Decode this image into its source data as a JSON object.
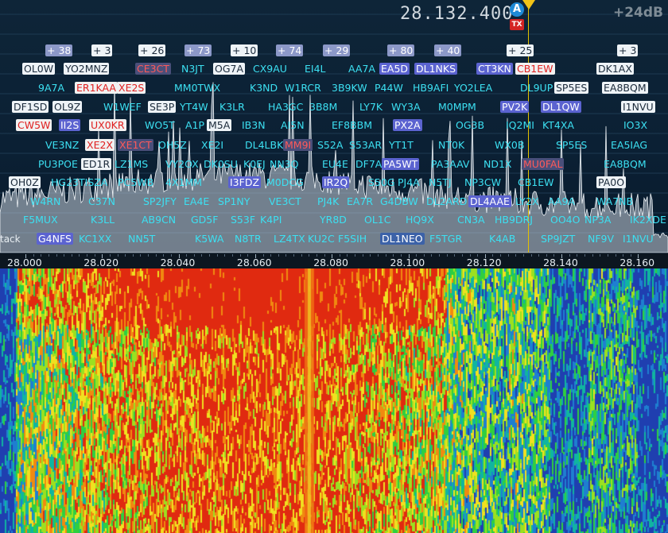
{
  "vfo": {
    "frequency": "28.132.400",
    "vfo_label": "A",
    "tx_label": "TX",
    "gain": "+24dB"
  },
  "partial_label": "tack",
  "colors": {
    "marker": "#f2c316",
    "tx": "#d42424",
    "vfo": "#1e8ad6",
    "callsign": "#3ce0f2"
  },
  "scale": {
    "labels": [
      "28.000",
      "28.020",
      "28.040",
      "28.060",
      "28.080",
      "28.100",
      "28.120",
      "28.140",
      "28.160"
    ]
  },
  "spots": [
    {
      "t": "+ 38",
      "s": "nb"
    },
    {
      "t": "+ 3",
      "s": "w"
    },
    {
      "t": "+ 26",
      "s": "w"
    },
    {
      "t": "+ 73",
      "s": "nb"
    },
    {
      "t": "+ 10",
      "s": "w"
    },
    {
      "t": "+ 74",
      "s": "nb"
    },
    {
      "t": "+ 29",
      "s": "nb"
    },
    {
      "t": "+ 80",
      "s": "nb"
    },
    {
      "t": "+ 40",
      "s": "nb"
    },
    {
      "t": "+ 25",
      "s": "w"
    },
    {
      "t": "+ 3",
      "s": "w"
    },
    {
      "t": "OL0W",
      "s": "w"
    },
    {
      "t": "YO2MNZ",
      "s": "w"
    },
    {
      "t": "CE3CT",
      "s": "rb"
    },
    {
      "t": "N3JT",
      "s": "c"
    },
    {
      "t": "OG7A",
      "s": "w"
    },
    {
      "t": "CX9AU",
      "s": "c"
    },
    {
      "t": "EI4L",
      "s": "c"
    },
    {
      "t": "AA7A",
      "s": "c"
    },
    {
      "t": "EA5D",
      "s": "b"
    },
    {
      "t": "DL1NKS",
      "s": "b"
    },
    {
      "t": "CT3KN",
      "s": "b"
    },
    {
      "t": "CB1EW",
      "s": "r"
    },
    {
      "t": "DK1AX",
      "s": "w"
    },
    {
      "t": "9A7A",
      "s": "c"
    },
    {
      "t": "ER1KAA",
      "s": "r"
    },
    {
      "t": "XE2S",
      "s": "r"
    },
    {
      "t": "MM0TWX",
      "s": "c"
    },
    {
      "t": "K3ND",
      "s": "c"
    },
    {
      "t": "W1RCR",
      "s": "c"
    },
    {
      "t": "3B9KW",
      "s": "c"
    },
    {
      "t": "P44W",
      "s": "c"
    },
    {
      "t": "HB9AFI",
      "s": "c"
    },
    {
      "t": "YO2LEA",
      "s": "c"
    },
    {
      "t": "DL9UP",
      "s": "c"
    },
    {
      "t": "SP5ES",
      "s": "w"
    },
    {
      "t": "EA8BQM",
      "s": "w"
    },
    {
      "t": "DF1SD",
      "s": "w"
    },
    {
      "t": "OL9Z",
      "s": "w"
    },
    {
      "t": "W1WEF",
      "s": "c"
    },
    {
      "t": "SE3P",
      "s": "w"
    },
    {
      "t": "YT4W",
      "s": "c"
    },
    {
      "t": "K3LR",
      "s": "c"
    },
    {
      "t": "HA3GC",
      "s": "c"
    },
    {
      "t": "3B8M",
      "s": "c"
    },
    {
      "t": "LY7K",
      "s": "c"
    },
    {
      "t": "WY3A",
      "s": "c"
    },
    {
      "t": "M0MPM",
      "s": "c"
    },
    {
      "t": "PV2K",
      "s": "b"
    },
    {
      "t": "DL1QW",
      "s": "b"
    },
    {
      "t": "I1NVU",
      "s": "w"
    },
    {
      "t": "CW5W",
      "s": "r"
    },
    {
      "t": "II2S",
      "s": "b"
    },
    {
      "t": "UX0KR",
      "s": "r"
    },
    {
      "t": "WO5T",
      "s": "c"
    },
    {
      "t": "A1P",
      "s": "c"
    },
    {
      "t": "M5A",
      "s": "w"
    },
    {
      "t": "IB3N",
      "s": "c"
    },
    {
      "t": "AI5N",
      "s": "c"
    },
    {
      "t": "EF8BBM",
      "s": "c"
    },
    {
      "t": "PX2A",
      "s": "b"
    },
    {
      "t": "OG3B",
      "s": "c"
    },
    {
      "t": "IQ2MI",
      "s": "c"
    },
    {
      "t": "KT4XA",
      "s": "c"
    },
    {
      "t": "IO3X",
      "s": "c"
    },
    {
      "t": "VE3NZ",
      "s": "c"
    },
    {
      "t": "XE2X",
      "s": "r"
    },
    {
      "t": "XE1CT",
      "s": "rb"
    },
    {
      "t": "OH5Z",
      "s": "c"
    },
    {
      "t": "XE2I",
      "s": "c"
    },
    {
      "t": "DL4LBK",
      "s": "c"
    },
    {
      "t": "MM9I",
      "s": "rb"
    },
    {
      "t": "S52A",
      "s": "c"
    },
    {
      "t": "S53AR",
      "s": "c"
    },
    {
      "t": "YT1T",
      "s": "c"
    },
    {
      "t": "NT0K",
      "s": "c"
    },
    {
      "t": "WX0B",
      "s": "c"
    },
    {
      "t": "SP5ES",
      "s": "c"
    },
    {
      "t": "EA5IAG",
      "s": "c"
    },
    {
      "t": "PU3POE",
      "s": "c"
    },
    {
      "t": "ED1R",
      "s": "w"
    },
    {
      "t": "LZ1MS",
      "s": "c"
    },
    {
      "t": "VY2OX",
      "s": "c"
    },
    {
      "t": "DK0SU",
      "s": "c"
    },
    {
      "t": "K0EJ",
      "s": "c"
    },
    {
      "t": "NN3Q",
      "s": "c"
    },
    {
      "t": "EU4E",
      "s": "c"
    },
    {
      "t": "DF7A",
      "s": "c"
    },
    {
      "t": "PA5WT",
      "s": "b"
    },
    {
      "t": "PA3AAV",
      "s": "c"
    },
    {
      "t": "ND1X",
      "s": "c"
    },
    {
      "t": "MU0FAL",
      "s": "rb"
    },
    {
      "t": "EA8BQM",
      "s": "c"
    },
    {
      "t": "OH0Z",
      "s": "w"
    },
    {
      "t": "HG23TISZA",
      "s": "c"
    },
    {
      "t": "PC5WB",
      "s": "c"
    },
    {
      "t": "4X1MM",
      "s": "c"
    },
    {
      "t": "I3FDZ",
      "s": "b"
    },
    {
      "t": "M0DCG",
      "s": "c"
    },
    {
      "t": "IR2Q",
      "s": "b"
    },
    {
      "t": "S50G",
      "s": "c"
    },
    {
      "t": "PJ4A",
      "s": "c"
    },
    {
      "t": "N5TJ",
      "s": "c"
    },
    {
      "t": "NP3CW",
      "s": "c"
    },
    {
      "t": "CB1EW",
      "s": "c"
    },
    {
      "t": "PA0O",
      "s": "w"
    },
    {
      "t": "W4RN",
      "s": "c"
    },
    {
      "t": "C37N",
      "s": "c"
    },
    {
      "t": "SP2JFY",
      "s": "c"
    },
    {
      "t": "EA4E",
      "s": "c"
    },
    {
      "t": "SP1NY",
      "s": "c"
    },
    {
      "t": "VE3CT",
      "s": "c"
    },
    {
      "t": "PJ4K",
      "s": "c"
    },
    {
      "t": "EA7R",
      "s": "c"
    },
    {
      "t": "G4DBW",
      "s": "c"
    },
    {
      "t": "DL2ARD",
      "s": "c"
    },
    {
      "t": "DL4AAE",
      "s": "b"
    },
    {
      "t": "LY2X",
      "s": "c"
    },
    {
      "t": "AA9A",
      "s": "c"
    },
    {
      "t": "WA7NB",
      "s": "c"
    },
    {
      "t": "F5MUX",
      "s": "c"
    },
    {
      "t": "K3LL",
      "s": "c"
    },
    {
      "t": "AB9CN",
      "s": "c"
    },
    {
      "t": "GD5F",
      "s": "c"
    },
    {
      "t": "S53F",
      "s": "c"
    },
    {
      "t": "K4PI",
      "s": "c"
    },
    {
      "t": "YR8D",
      "s": "c"
    },
    {
      "t": "OL1C",
      "s": "c"
    },
    {
      "t": "HQ9X",
      "s": "c"
    },
    {
      "t": "CN3A",
      "s": "c"
    },
    {
      "t": "HB9DRJ",
      "s": "c"
    },
    {
      "t": "OO4O",
      "s": "c"
    },
    {
      "t": "NP3A",
      "s": "c"
    },
    {
      "t": "IK2XDE",
      "s": "c"
    },
    {
      "t": "G4NFS",
      "s": "b"
    },
    {
      "t": "KC1XX",
      "s": "c"
    },
    {
      "t": "NN5T",
      "s": "c"
    },
    {
      "t": "K5WA",
      "s": "c"
    },
    {
      "t": "N8TR",
      "s": "c"
    },
    {
      "t": "LZ4TX",
      "s": "c"
    },
    {
      "t": "KU2C",
      "s": "c"
    },
    {
      "t": "F5SIH",
      "s": "c"
    },
    {
      "t": "DL1NEO",
      "s": "n"
    },
    {
      "t": "F5TGR",
      "s": "c"
    },
    {
      "t": "K4AB",
      "s": "c"
    },
    {
      "t": "SP9JZT",
      "s": "c"
    },
    {
      "t": "NF9V",
      "s": "c"
    },
    {
      "t": "I1NVU",
      "s": "c"
    }
  ]
}
